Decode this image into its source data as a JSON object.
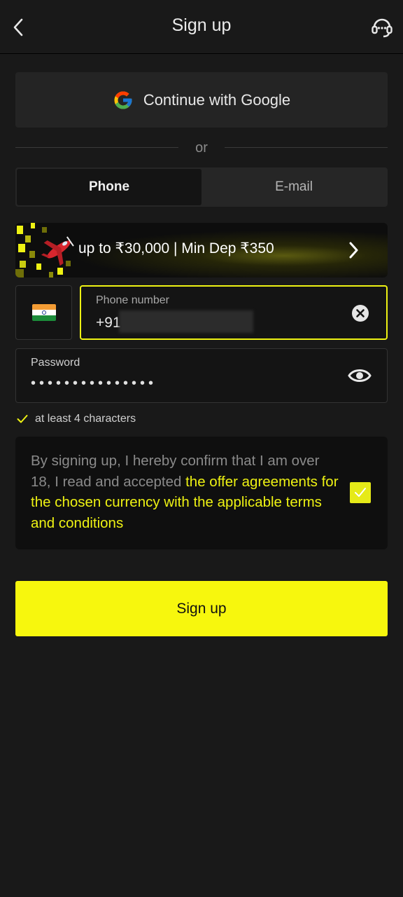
{
  "header": {
    "title": "Sign up",
    "back_icon": "chevron-left-icon",
    "support_icon": "headset-icon"
  },
  "google": {
    "label": "Continue with Google",
    "icon": "google-icon"
  },
  "divider": {
    "text": "or"
  },
  "tabs": [
    {
      "label": "Phone",
      "active": true
    },
    {
      "label": "E-mail",
      "active": false
    }
  ],
  "promo": {
    "text": "up to ₹30,000 | Min Dep ₹350",
    "icon": "airplane-icon"
  },
  "phone": {
    "country_flag": "india-flag-icon",
    "label": "Phone number",
    "prefix": "+91",
    "value_redacted": true
  },
  "password": {
    "label": "Password",
    "masked_value": "•••••••••••••••"
  },
  "password_rule": {
    "text": "at least 4 characters",
    "satisfied": true
  },
  "consent": {
    "text_plain": "By signing up, I hereby confirm that I am over 18, I read and accepted ",
    "text_link": "the offer agreements for the chosen currency with the applicable terms and conditions",
    "checked": true
  },
  "signup_button": {
    "label": "Sign up"
  },
  "colors": {
    "accent": "#f7f70d",
    "background": "#191919",
    "surface": "#242424",
    "field": "#141414"
  }
}
